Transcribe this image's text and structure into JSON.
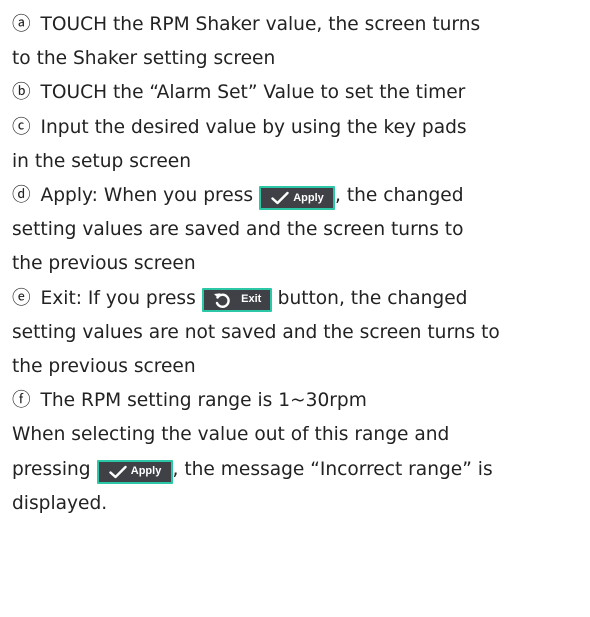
{
  "items": {
    "a": {
      "marker": "ⓐ",
      "line1": "TOUCH the RPM Shaker value, the screen turns",
      "line2": "to the Shaker setting screen"
    },
    "b": {
      "marker": "ⓑ",
      "line1": "TOUCH the “Alarm Set” Value to set the timer"
    },
    "c": {
      "marker": "ⓒ",
      "line1": "Input the desired value by using the key pads",
      "line2": "in the setup screen"
    },
    "d": {
      "marker": "ⓓ",
      "line1_before": "Apply: When you press",
      "line1_after": ", the changed",
      "line2": "setting values are saved and the screen turns to",
      "line3": "the previous screen"
    },
    "e": {
      "marker": "ⓔ",
      "line1_before": "Exit: If you press",
      "line1_after": "button, the changed",
      "line2": "setting values are not saved and the screen turns to",
      "line3": "the previous screen"
    },
    "f": {
      "marker": "ⓕ",
      "line1": "The RPM setting range is 1~30rpm",
      "line2": "When selecting the value out of this range and",
      "line3_before": "pressing",
      "line3_after": ", the message “Incorrect range” is",
      "line4": "displayed."
    }
  },
  "buttons": {
    "apply_label": "Apply",
    "exit_label": "Exit"
  },
  "colors": {
    "button_bg": "#3f4147",
    "button_border": "#2cc7a7",
    "apply_check": "#ffffff",
    "exit_arrow": "#ffffff",
    "text": "#222222"
  },
  "icons": {
    "apply": "checkmark-icon",
    "exit": "undo-arrow-icon"
  }
}
